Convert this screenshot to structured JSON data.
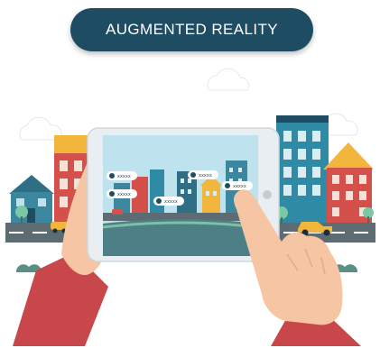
{
  "banner": {
    "title": "AUGMENTED REALITY"
  },
  "ar_tags": [
    {
      "label": "xxxxx"
    },
    {
      "label": "xxxxx"
    },
    {
      "label": "xxxxx"
    },
    {
      "label": "xxxxx"
    },
    {
      "label": "xxxxx"
    }
  ],
  "colors": {
    "banner": "#1e4d63",
    "sky": "#bfe3ee",
    "road": "#5d6b73",
    "skin": "#f6c5a4",
    "sleeve": "#c8474a",
    "tablet": "#e9eef2"
  }
}
